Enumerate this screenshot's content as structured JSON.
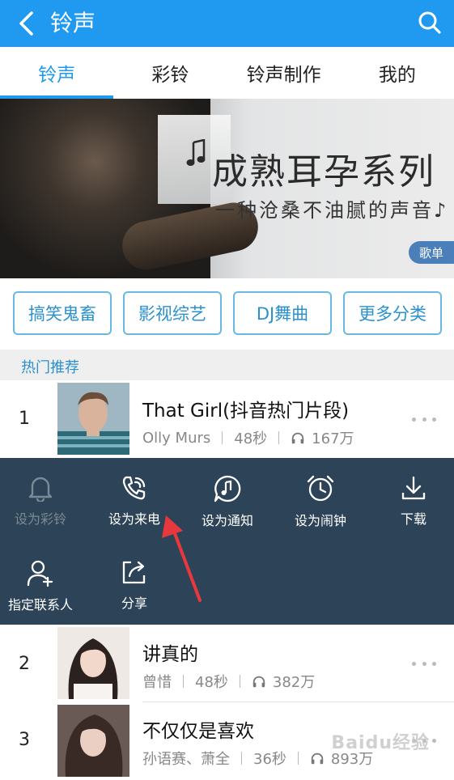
{
  "header": {
    "title": "铃声"
  },
  "tabs": [
    {
      "label": "铃声",
      "active": true
    },
    {
      "label": "彩铃",
      "active": false
    },
    {
      "label": "铃声制作",
      "active": false
    },
    {
      "label": "我的",
      "active": false
    }
  ],
  "banner": {
    "title": "成熟耳孕系列",
    "subtitle": "一种沧桑不油腻的声音♪",
    "tag": "歌单"
  },
  "categories": [
    "搞笑鬼畜",
    "影视综艺",
    "DJ舞曲",
    "更多分类"
  ],
  "section": {
    "title": "热门推荐"
  },
  "songs": [
    {
      "rank": "1",
      "title": "That Girl(抖音热门片段)",
      "artist": "Olly Murs",
      "duration": "48秒",
      "plays": "167万"
    },
    {
      "rank": "2",
      "title": "讲真的",
      "artist": "曾惜",
      "duration": "48秒",
      "plays": "382万"
    },
    {
      "rank": "3",
      "title": "不仅仅是喜欢",
      "artist": "孙语赛、萧全",
      "duration": "36秒",
      "plays": "893万"
    }
  ],
  "actions": [
    {
      "label": "设为彩铃",
      "icon": "bell-icon",
      "enabled": false
    },
    {
      "label": "设为来电",
      "icon": "phone-ring-icon",
      "enabled": true
    },
    {
      "label": "设为通知",
      "icon": "music-bubble-icon",
      "enabled": true
    },
    {
      "label": "设为闹钟",
      "icon": "alarm-clock-icon",
      "enabled": true
    },
    {
      "label": "下载",
      "icon": "download-icon",
      "enabled": true
    },
    {
      "label": "指定联系人",
      "icon": "add-contact-icon",
      "enabled": true
    },
    {
      "label": "分享",
      "icon": "share-icon",
      "enabled": true
    }
  ],
  "watermark": "Baidu经验",
  "colors": {
    "header": "#1f9af0",
    "accent": "#1f9af0",
    "panel": "#2d4458",
    "annotation_arrow": "#e8383d"
  }
}
